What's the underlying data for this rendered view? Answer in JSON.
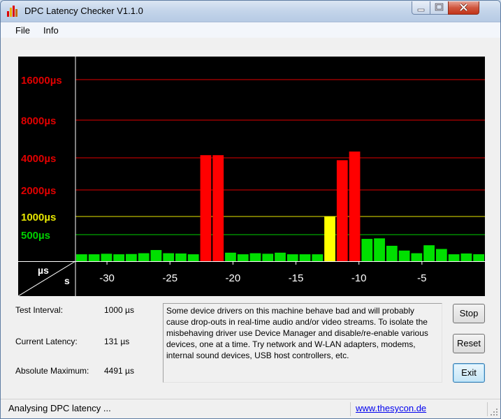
{
  "window": {
    "title": "DPC Latency Checker V1.1.0"
  },
  "menu": {
    "file": "File",
    "info": "Info"
  },
  "chart_data": {
    "type": "bar",
    "ylabel": "µs",
    "xlabel": "s",
    "y_ticks": [
      {
        "label": "16000µs",
        "value": 16000,
        "color": "#e00000"
      },
      {
        "label": "8000µs",
        "value": 8000,
        "color": "#e00000"
      },
      {
        "label": "4000µs",
        "value": 4000,
        "color": "#e00000"
      },
      {
        "label": "2000µs",
        "value": 2000,
        "color": "#e00000"
      },
      {
        "label": "1000µs",
        "value": 1000,
        "color": "#e6e600"
      },
      {
        "label": "500µs",
        "value": 500,
        "color": "#00d000"
      }
    ],
    "x_ticks": [
      {
        "label": "-30",
        "value": -30
      },
      {
        "label": "-25",
        "value": -25
      },
      {
        "label": "-20",
        "value": -20
      },
      {
        "label": "-15",
        "value": -15
      },
      {
        "label": "-10",
        "value": -10
      },
      {
        "label": "-5",
        "value": -5
      }
    ],
    "x_range": [
      -32.5,
      0
    ],
    "bars_us": [
      130,
      130,
      140,
      130,
      135,
      150,
      210,
      150,
      145,
      130,
      4200,
      4200,
      160,
      130,
      150,
      140,
      160,
      130,
      130,
      130,
      1000,
      3800,
      4491,
      420,
      430,
      290,
      200,
      150,
      300,
      230,
      130,
      145,
      131
    ],
    "colors": {
      "green": "#00e000",
      "yellow": "#ffff00",
      "red": "#ff0000"
    }
  },
  "info": {
    "test_interval_label": "Test Interval:",
    "test_interval_value": "1000 µs",
    "current_latency_label": "Current Latency:",
    "current_latency_value": "131 µs",
    "absolute_maximum_label": "Absolute Maximum:",
    "absolute_maximum_value": "4491 µs"
  },
  "message": "Some device drivers on this machine behave bad and will probably cause drop-outs in real-time audio and/or video streams. To isolate the misbehaving driver use Device Manager and disable/re-enable various devices, one at a time. Try network and W-LAN adapters, modems, internal sound devices, USB host controllers, etc.",
  "buttons": {
    "stop": "Stop",
    "reset": "Reset",
    "exit": "Exit"
  },
  "status": {
    "text": "Analysing DPC latency ...",
    "link": "www.thesycon.de"
  },
  "icons": {
    "app": "bar-chart-icon",
    "minimize": "minimize-icon",
    "maximize": "maximize-icon",
    "close": "close-icon",
    "grip": "resize-grip-icon"
  }
}
